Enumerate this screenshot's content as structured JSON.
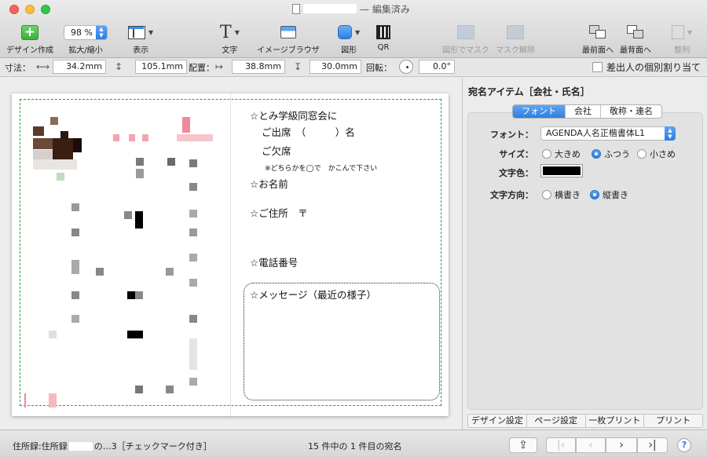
{
  "window": {
    "title_suffix": "— 編集済み"
  },
  "toolbar": {
    "design_create": "デザイン作成",
    "zoom_value": "98 %",
    "zoom_label": "拡大/縮小",
    "view_label": "表示",
    "text_label": "文字",
    "image_browser_label": "イメージブラウザ",
    "shape_label": "図形",
    "qr_label": "QR",
    "mask_with_shape_label": "図形でマスク",
    "unmask_label": "マスク解除",
    "bring_front_label": "最前面へ",
    "send_back_label": "最背面へ",
    "align_label": "整列"
  },
  "measure": {
    "size_label": "寸法：",
    "width": "34.2mm",
    "height": "105.1mm",
    "position_label": "配置：",
    "x": "38.8mm",
    "y": "30.0mm",
    "rotation_label": "回転：",
    "rotation": "0.0°",
    "sender_assign_label": "差出人の個別割り当て"
  },
  "card": {
    "line1": "☆とみ学級同窓会に",
    "attend": "ご出席　（　　　）名",
    "absent": "ご欠席",
    "note": "※どちらかを◯で　かこんで下さい",
    "name": "☆お名前",
    "address": "☆ご住所　〒",
    "phone": "☆電話番号",
    "message": "☆メッセージ（最近の様子）"
  },
  "panel": {
    "title": "宛名アイテム［会社・氏名］",
    "tabs": [
      "フォント",
      "会社",
      "敬称・連名"
    ],
    "font_label": "フォント：",
    "font_value": "AGENDA人名正楷書体L1",
    "size_label": "サイズ：",
    "size_options": [
      "大きめ",
      "ふつう",
      "小さめ"
    ],
    "color_label": "文字色：",
    "direction_label": "文字方向：",
    "direction_options": [
      "横書き",
      "縦書き"
    ],
    "bottom_tabs": [
      "デザイン設定",
      "ページ設定",
      "一枚プリント",
      "プリント"
    ]
  },
  "status": {
    "left_prefix": "住所録:住所録",
    "left_suffix": "の…3［チェックマーク付き］",
    "center": "15 件中の 1 件目の宛名"
  },
  "colors": {
    "accent": "#2f7de1",
    "guide": "#2a9d3a"
  }
}
